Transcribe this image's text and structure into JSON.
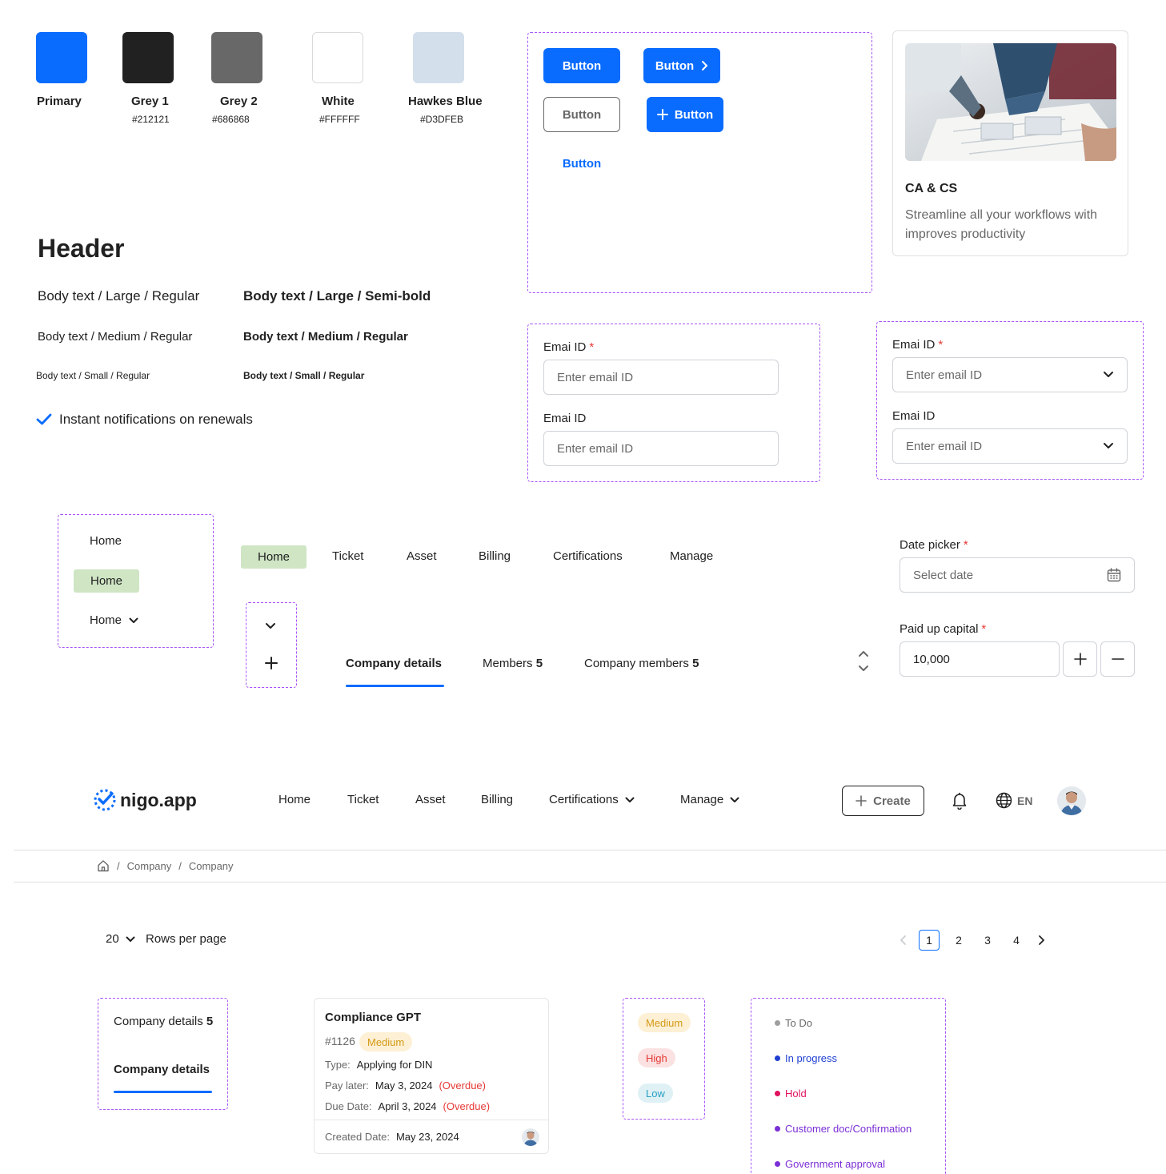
{
  "palette": [
    {
      "name": "Primary",
      "hex": "",
      "color": "#0a6cff"
    },
    {
      "name": "Grey 1",
      "hex": "#212121",
      "color": "#212121"
    },
    {
      "name": "Grey 2",
      "hex": "#686868",
      "color": "#686868"
    },
    {
      "name": "White",
      "hex": "#FFFFFF",
      "color": "#FFFFFF"
    },
    {
      "name": "Hawkes Blue",
      "hex": "#D3DFEB",
      "color": "#D3DFEB"
    }
  ],
  "buttons": {
    "primary": "Button",
    "primary_next": "Button",
    "outline": "Button",
    "primary_add": "Button",
    "text": "Button"
  },
  "promo_card": {
    "title": "CA & CS",
    "description": "Streamline all your workflows with improves productivity"
  },
  "typography": {
    "header": "Header",
    "large_regular": "Body text / Large / Regular",
    "large_semibold": "Body text /  Large / Semi-bold",
    "medium_regular": "Body text / Medium / Regular",
    "medium_bold": "Body text / Medium / Regular",
    "small_regular": "Body text / Small / Regular",
    "small_bold": "Body text / Small / Regular",
    "checklist_item": "Instant notifications on renewals"
  },
  "form_text": {
    "field1_label": "Emai ID",
    "field1_placeholder": "Enter email ID",
    "field2_label": "Emai ID",
    "field2_placeholder": "Enter email ID"
  },
  "form_select": {
    "field1_label": "Emai ID",
    "field1_placeholder": "Enter email ID",
    "field2_label": "Emai ID",
    "field2_placeholder": "Enter email ID"
  },
  "side_menu": {
    "item_default": "Home",
    "item_active": "Home",
    "item_dropdown": "Home"
  },
  "top_tabs": [
    "Home",
    "Ticket",
    "Asset",
    "Billing",
    "Certifications",
    "Manage"
  ],
  "detail_tabs": {
    "company_details": "Company details",
    "members": "Members",
    "members_count": "5",
    "company_members": "Company members",
    "company_members_count": "5"
  },
  "date_picker": {
    "label": "Date picker",
    "placeholder": "Select date"
  },
  "stepper": {
    "label": "Paid up capital",
    "value": "10,000"
  },
  "navbar": {
    "brand": "nigo.app",
    "items": [
      "Home",
      "Ticket",
      "Asset",
      "Billing"
    ],
    "certifications": "Certifications",
    "manage": "Manage",
    "create": "Create",
    "language": "EN"
  },
  "breadcrumb": [
    "Company",
    "Company"
  ],
  "pagination": {
    "rows_value": "20",
    "rows_label": "Rows per page",
    "pages": [
      "1",
      "2",
      "3",
      "4"
    ],
    "current": "1"
  },
  "tab_variants": {
    "with_count_label": "Company details",
    "with_count_value": "5",
    "active_label": "Company details"
  },
  "ticket_card": {
    "title": "Compliance GPT",
    "id": "#1126",
    "priority": "Medium",
    "type_label": "Type:",
    "type_value": "Applying for DIN",
    "pay_label": "Pay later:",
    "pay_value": "May 3, 2024",
    "pay_status": "(Overdue)",
    "due_label": "Due Date:",
    "due_value": "April 3, 2024",
    "due_status": "(Overdue)",
    "created_label": "Created Date:",
    "created_value": "May 23, 2024"
  },
  "priority_badges": [
    "Medium",
    "High",
    "Low"
  ],
  "statuses": [
    {
      "label": "To Do",
      "color": "#9e9e9e"
    },
    {
      "label": "In progress",
      "color": "#1e3fd1"
    },
    {
      "label": "Hold",
      "color": "#e0115f"
    },
    {
      "label": "Customer doc/Confirmation",
      "color": "#7b2fd6"
    },
    {
      "label": "Government approval",
      "color": "#7b2fd6"
    }
  ]
}
